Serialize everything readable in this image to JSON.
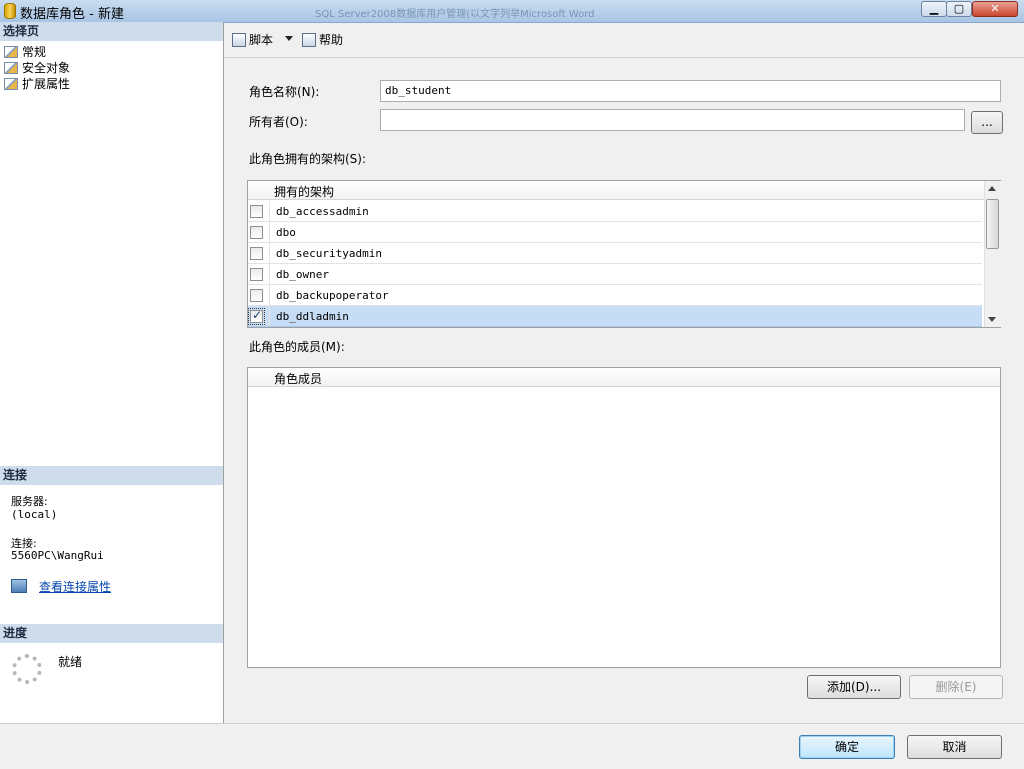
{
  "window": {
    "title": "数据库角色 - 新建",
    "background_title": "SQL Server2008数据库用户管理(以文字列举Microsoft Word"
  },
  "left_panel": {
    "select_page_header": "选择页",
    "pages": [
      {
        "label": "常规",
        "icon": "page-icon"
      },
      {
        "label": "安全对象",
        "icon": "page-icon"
      },
      {
        "label": "扩展属性",
        "icon": "page-icon"
      }
    ],
    "connection_header": "连接",
    "server_label": "服务器:",
    "server_value": "(local)",
    "connection_label": "连接:",
    "connection_value": "5560PC\\WangRui",
    "view_connection_link": "查看连接属性",
    "progress_header": "进度",
    "progress_status": "就绪"
  },
  "toolbar": {
    "script_label": "脚本",
    "help_label": "帮助"
  },
  "form": {
    "role_name_label": "角色名称(N):",
    "role_name_value": "db_student",
    "owner_label": "所有者(O):",
    "owner_value": "",
    "browse_button": "...",
    "schemas_label": "此角色拥有的架构(S):",
    "schemas_column": "拥有的架构",
    "schemas": [
      {
        "name": "db_accessadmin",
        "checked": false
      },
      {
        "name": "dbo",
        "checked": false
      },
      {
        "name": "db_securityadmin",
        "checked": false
      },
      {
        "name": "db_owner",
        "checked": false
      },
      {
        "name": "db_backupoperator",
        "checked": false
      },
      {
        "name": "db_ddladmin",
        "checked": true
      }
    ],
    "members_label": "此角色的成员(M):",
    "members_column": "角色成员",
    "add_button": "添加(D)...",
    "remove_button": "删除(E)"
  },
  "footer": {
    "ok_button": "确定",
    "cancel_button": "取消"
  }
}
